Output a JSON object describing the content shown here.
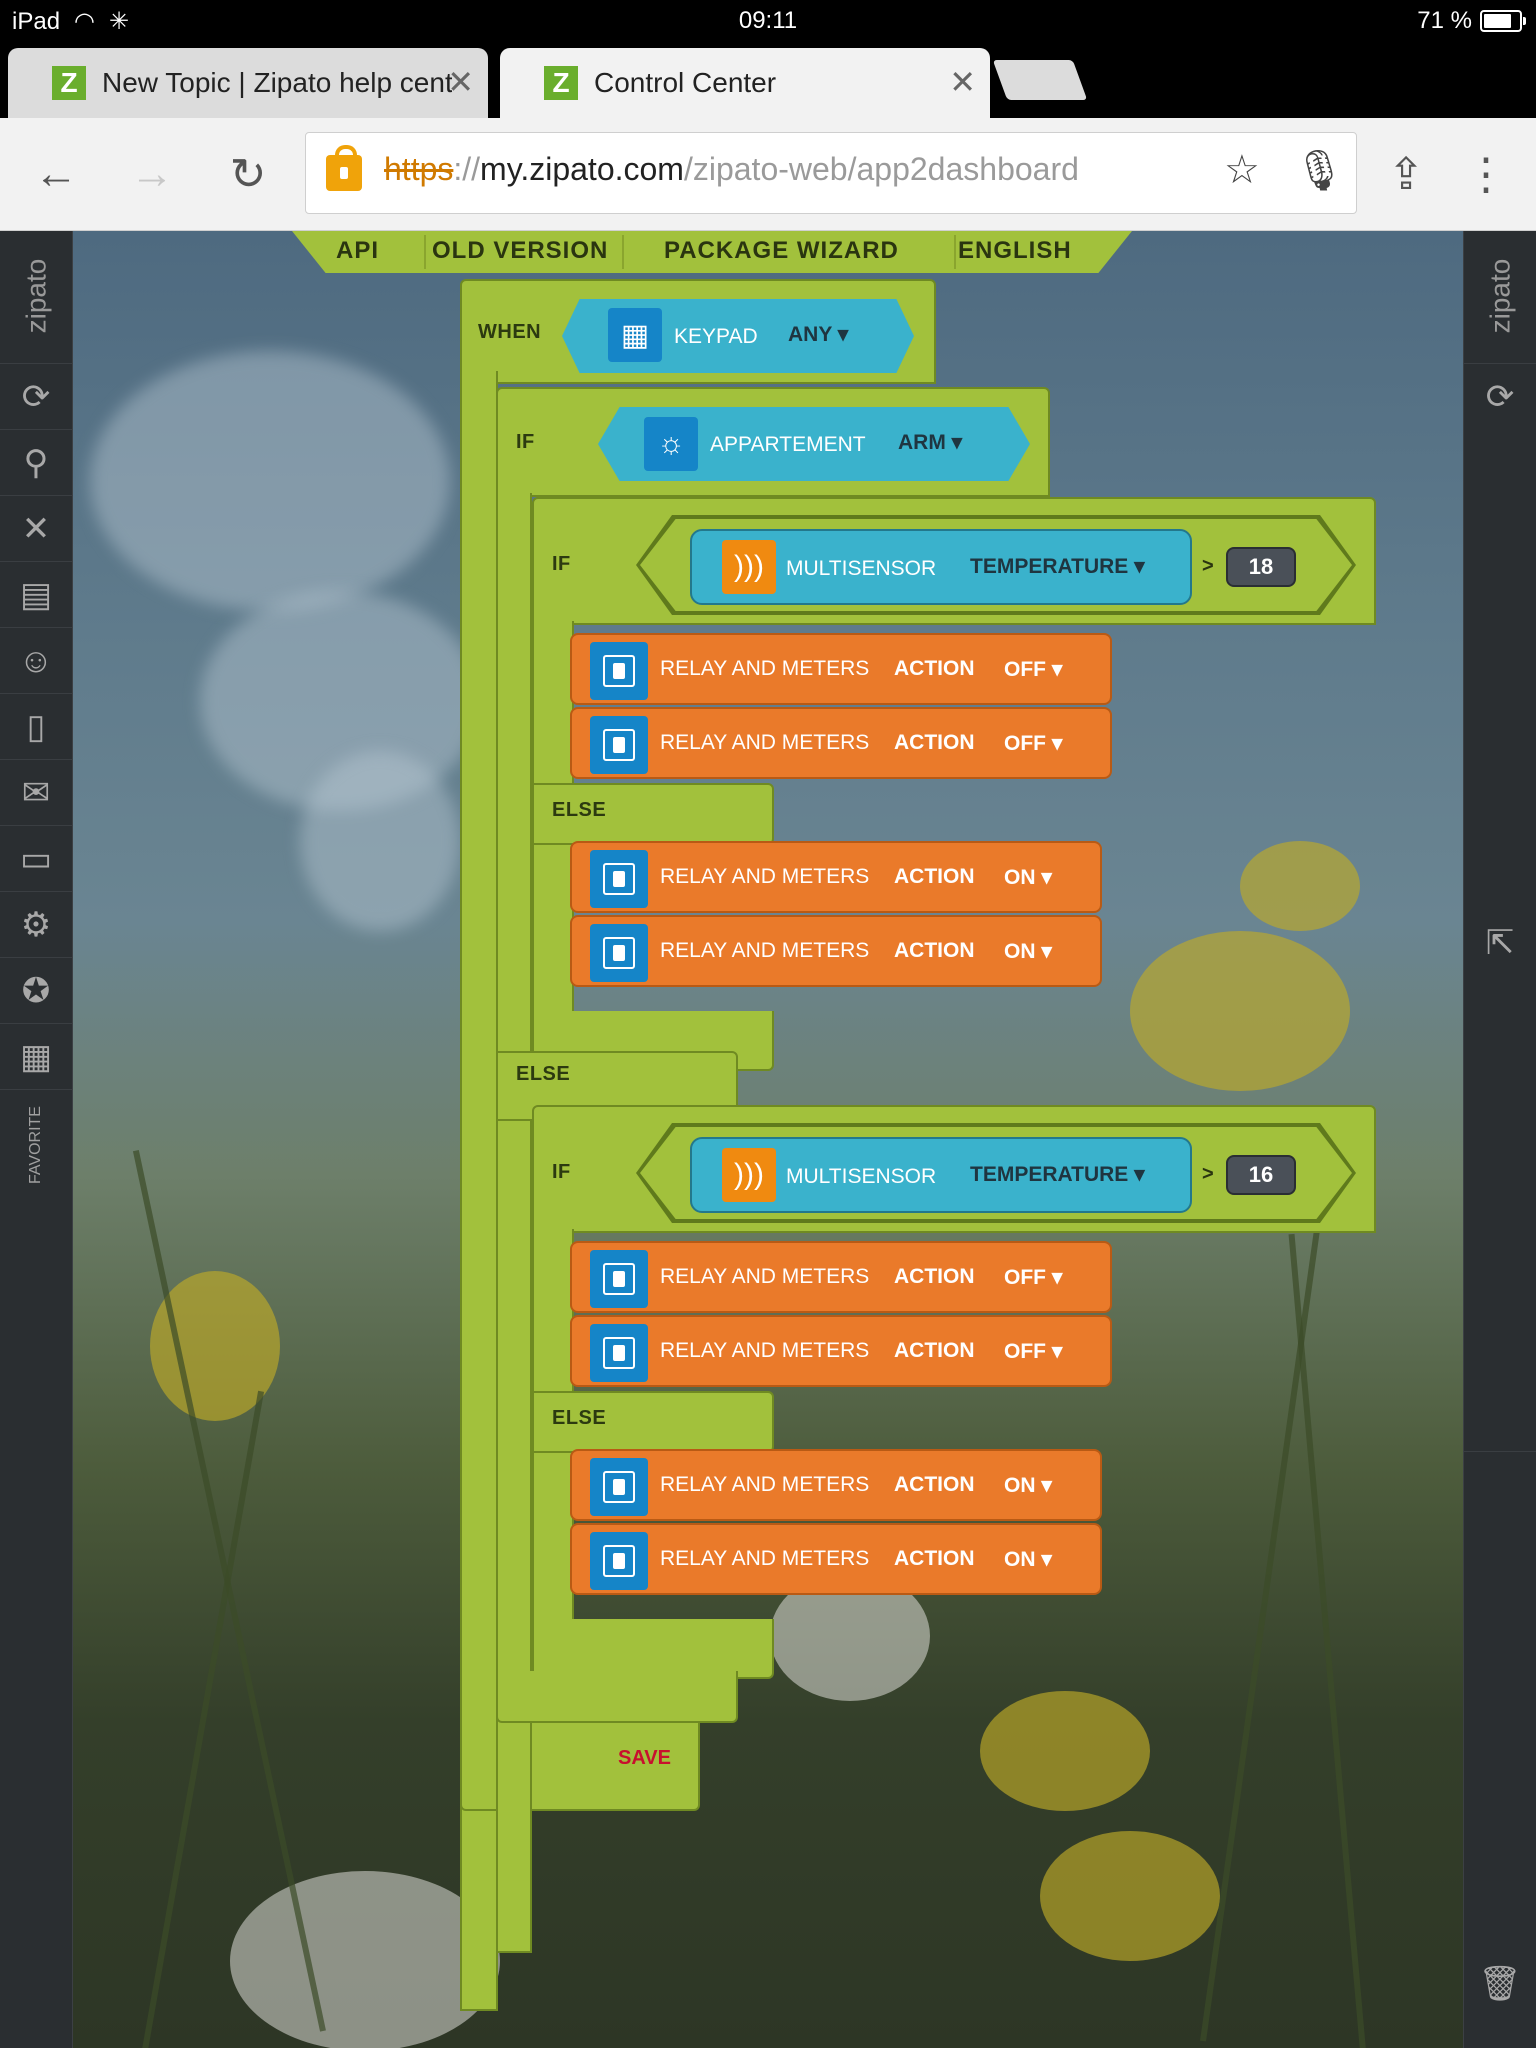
{
  "status": {
    "device": "iPad",
    "time": "09:11",
    "battery": "71 %"
  },
  "tabs": [
    {
      "title": "New Topic | Zipato help cent",
      "icon": "Z"
    },
    {
      "title": "Control Center",
      "icon": "Z"
    }
  ],
  "omnibox": {
    "scheme": "https",
    "sep": "://",
    "host": "my.zipato.com",
    "path": "/zipato-web/app2dashboard"
  },
  "sidebar": {
    "logo": "zipato",
    "favorite": "FAVORITE"
  },
  "menu": {
    "api": "API",
    "old_version": "OLD VERSION",
    "package_wizard": "PACKAGE WIZARD",
    "english": "ENGLISH"
  },
  "rule": {
    "when": "WHEN",
    "if": "IF",
    "else": "ELSE",
    "trigger": {
      "device": "KEYPAD",
      "option": "ANY"
    },
    "condition1": {
      "device": "APPARTEMENT",
      "option": "ARM"
    },
    "sensor": {
      "device": "MULTISENSOR",
      "attribute": "TEMPERATURE",
      "op": ">"
    },
    "threshold1": "18",
    "threshold2": "16",
    "relay": {
      "device": "RELAY AND METERS",
      "action": "ACTION",
      "off": "OFF",
      "on": "ON"
    },
    "save": "SAVE"
  },
  "colors": {
    "green": "#a2c13c",
    "orange": "#ea7a2a",
    "blue": "#3ab2cc"
  }
}
